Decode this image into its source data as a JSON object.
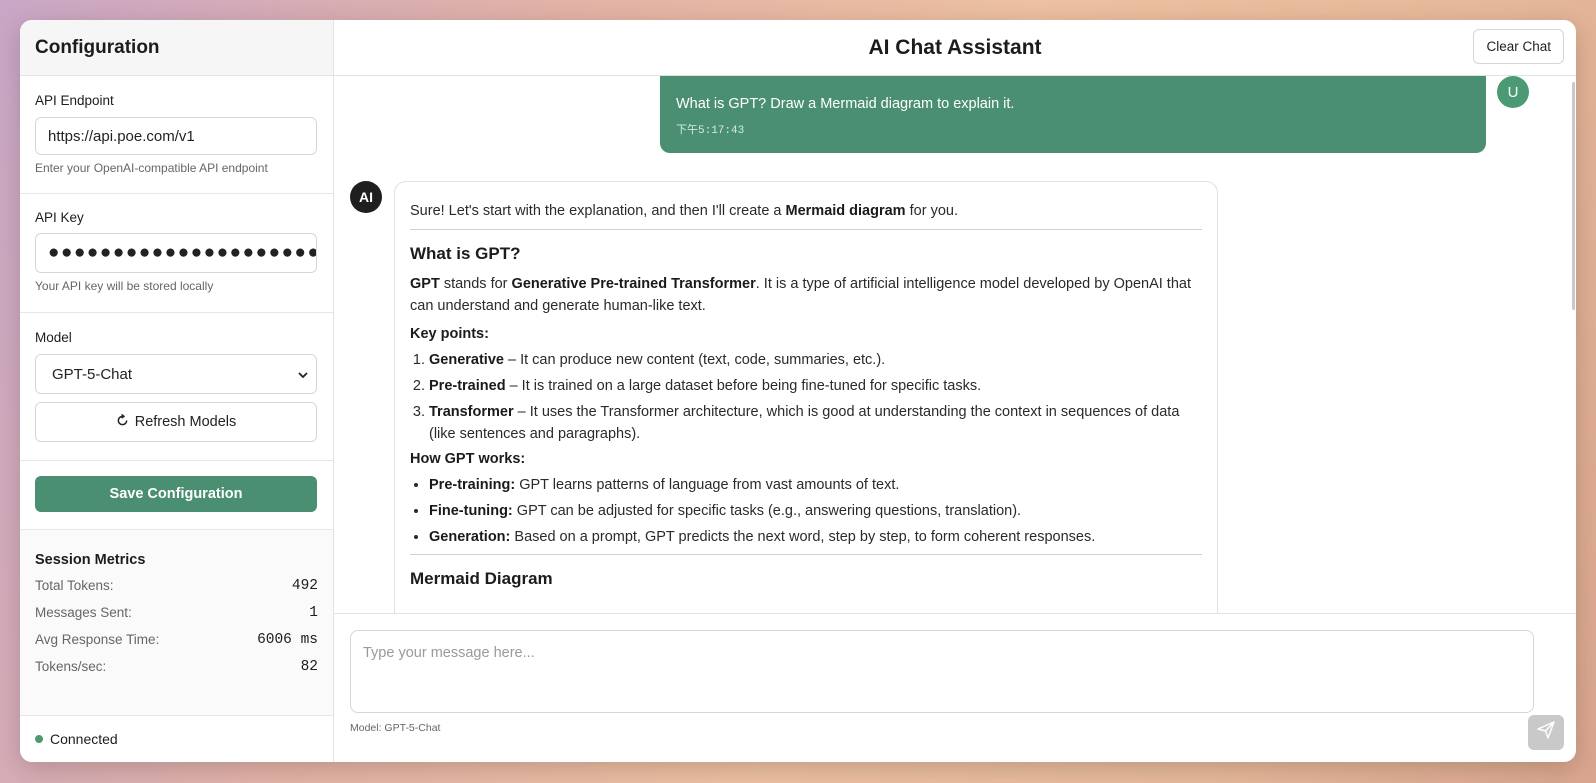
{
  "sidebar": {
    "title": "Configuration",
    "api_endpoint": {
      "label": "API Endpoint",
      "value": "https://api.poe.com/v1",
      "hint": "Enter your OpenAI-compatible API endpoint"
    },
    "api_key": {
      "label": "API Key",
      "value": "●●●●●●●●●●●●●●●●●●●●●●●●●●",
      "hint": "Your API key will be stored locally"
    },
    "model": {
      "label": "Model",
      "selected": "GPT-5-Chat",
      "refresh_label": "Refresh Models"
    },
    "save_label": "Save Configuration",
    "metrics": {
      "title": "Session Metrics",
      "rows": [
        {
          "label": "Total Tokens:",
          "value": "492"
        },
        {
          "label": "Messages Sent:",
          "value": "1"
        },
        {
          "label": "Avg Response Time:",
          "value": "6006 ms"
        },
        {
          "label": "Tokens/sec:",
          "value": "82"
        }
      ]
    },
    "status": {
      "label": "Connected",
      "color": "#4a9a74"
    }
  },
  "header": {
    "title": "AI Chat Assistant",
    "clear_label": "Clear Chat"
  },
  "chat": {
    "user_message": {
      "text": "What is GPT? Draw a Mermaid diagram to explain it.",
      "time": "下午5:17:43",
      "avatar": "U"
    },
    "assistant": {
      "avatar": "AI",
      "intro_before": "Sure! Let's start with the explanation, and then I'll create a ",
      "intro_bold": "Mermaid diagram",
      "intro_after": " for you.",
      "heading1": "What is GPT?",
      "gpt_bold": "GPT",
      "gpt_mid": " stands for ",
      "gpt_full": "Generative Pre-trained Transformer",
      "gpt_rest": ". It is a type of artificial intelligence model developed by OpenAI that can understand and generate human-like text.",
      "key_points_title": "Key points:",
      "key_points": [
        {
          "term": "Generative",
          "text": " – It can produce new content (text, code, summaries, etc.)."
        },
        {
          "term": "Pre-trained",
          "text": " – It is trained on a large dataset before being fine-tuned for specific tasks."
        },
        {
          "term": "Transformer",
          "text": " – It uses the Transformer architecture, which is good at understanding the context in sequences of data (like sentences and paragraphs)."
        }
      ],
      "how_title": "How GPT works:",
      "how_points": [
        {
          "term": "Pre-training:",
          "text": " GPT learns patterns of language from vast amounts of text."
        },
        {
          "term": "Fine-tuning:",
          "text": " GPT can be adjusted for specific tasks (e.g., answering questions, translation)."
        },
        {
          "term": "Generation:",
          "text": " Based on a prompt, GPT predicts the next word, step by step, to form coherent responses."
        }
      ],
      "heading2": "Mermaid Diagram"
    }
  },
  "input": {
    "placeholder": "Type your message here...",
    "model_note": "Model: GPT-5-Chat"
  },
  "colors": {
    "accent": "#4a8f72",
    "send_button": "#c9c9c9"
  },
  "icons": {
    "refresh": "refresh-icon",
    "send": "send-icon",
    "select_chevron": "chevron-down-icon"
  }
}
